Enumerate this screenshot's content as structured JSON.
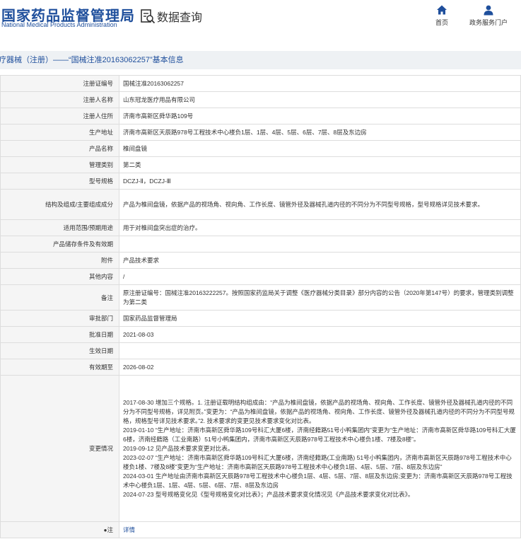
{
  "header": {
    "logo_cn": "国家药品监督管理局",
    "logo_en": "National Medical Products Administration",
    "query_label": "数据查询",
    "nav": [
      {
        "label": "首页",
        "icon": "home-icon"
      },
      {
        "label": "政务服务门户",
        "icon": "user-icon"
      }
    ]
  },
  "title_bar": "疗器械（注册）——“国械注准20163062257”基本信息",
  "rows": [
    {
      "label": "注册证编号",
      "value": "国械注准20163062257"
    },
    {
      "label": "注册人名称",
      "value": "山东冠龙医疗用品有限公司"
    },
    {
      "label": "注册人住所",
      "value": "济南市高新区舜华路109号"
    },
    {
      "label": "生产地址",
      "value": "济南市高新区天辰路978号工程技术中心楼负1层、1层、4层、5层、6层、7层、8层及东边房"
    },
    {
      "label": "产品名称",
      "value": "椎间盘镜"
    },
    {
      "label": "管理类别",
      "value": "第二类"
    },
    {
      "label": "型号规格",
      "value": "DCZJ-Ⅱ，DCZJ-Ⅲ"
    },
    {
      "label": "结构及组成/主要组成成分",
      "value": "产品为椎间盘镜，依据产品的视场角、视向角、工作长度、镜管外径及器械孔道内径的不同分为不同型号规格，型号规格详见技术要求。"
    },
    {
      "label": "适用范围/预期用途",
      "value": "用于对椎间盘突出症的治疗。"
    },
    {
      "label": "产品储存条件及有效期",
      "value": ""
    },
    {
      "label": "附件",
      "value": "产品技术要求"
    },
    {
      "label": "其他内容",
      "value": "/"
    },
    {
      "label": "备注",
      "value": "原注册证编号：国械注准20163222257。按照国家药监局关于调整《医疗器械分类目录》部分内容的公告（2020年第147号）的要求，管理类别调整为第二类"
    },
    {
      "label": "审批部门",
      "value": "国家药品监督管理局"
    },
    {
      "label": "批准日期",
      "value": "2021-08-03"
    },
    {
      "label": "生效日期",
      "value": ""
    },
    {
      "label": "有效期至",
      "value": "2026-08-02"
    }
  ],
  "changes": {
    "label": "变更情况",
    "lines": [
      "2017-08-30 增加三个规格。1. 注册证载明结构组成由：“产品为椎间盘镜，依据产品的视场角、视向角、工作长度、镜管外径及器械孔道内径的不同分为不同型号规格，详见附页。”变更为：“产品为椎间盘镜，依据产品的视场角、视向角、工作长度、镜管外径及器械孔道内径的不同分为不同型号规格，规格型号详见技术要求。”2. 技术要求的变更见技术要求变化对比表。",
      "2019-01-10 “生产地址：济南市高新区舜华路109号科汇大厦6楼，济南经籍路51号小鸭集团内”变更为“生产地址：济南市高新区舜华路109号科汇大厦6楼，济南经籍路（工业南路）51号小鸭集团内，济南市高新区天辰路978号工程技术中心楼负1楼、7楼及8楼”。",
      "2019-09-12 见产品技术要求变更对比表。",
      "2023-02-07 “生产地址：济南市高新区舜华路109号科汇大厦6楼，济南经籍路(工业南路) 51号小鸭集团内，济南市高新区天辰路978号工程技术中心楼负1楼、7楼及8楼”变更为“生产地址：济南市高新区天辰路978号工程技术中心楼负1层、4层、5层、7层、8层及东边房”",
      "2024-03-01 生产地址由济南市高新区天辰路978号工程技术中心楼负1层、4层、5层、7层、8层及东边房;变更为：济南市高新区天辰路978号工程技术中心楼负1层、1层、4层、5层、6层、7层、8层及东边房",
      "2024-07-23 型号规格变化见《型号规格变化对比表》；产品技术要求变化情况见《产品技术要求变化对比表》。"
    ]
  },
  "note": {
    "label": "注",
    "link": "详情"
  },
  "colors": {
    "brand": "#1f4f9c",
    "label_bg": "#f5f5f5",
    "titlebar_bg": "#eef1f4"
  }
}
